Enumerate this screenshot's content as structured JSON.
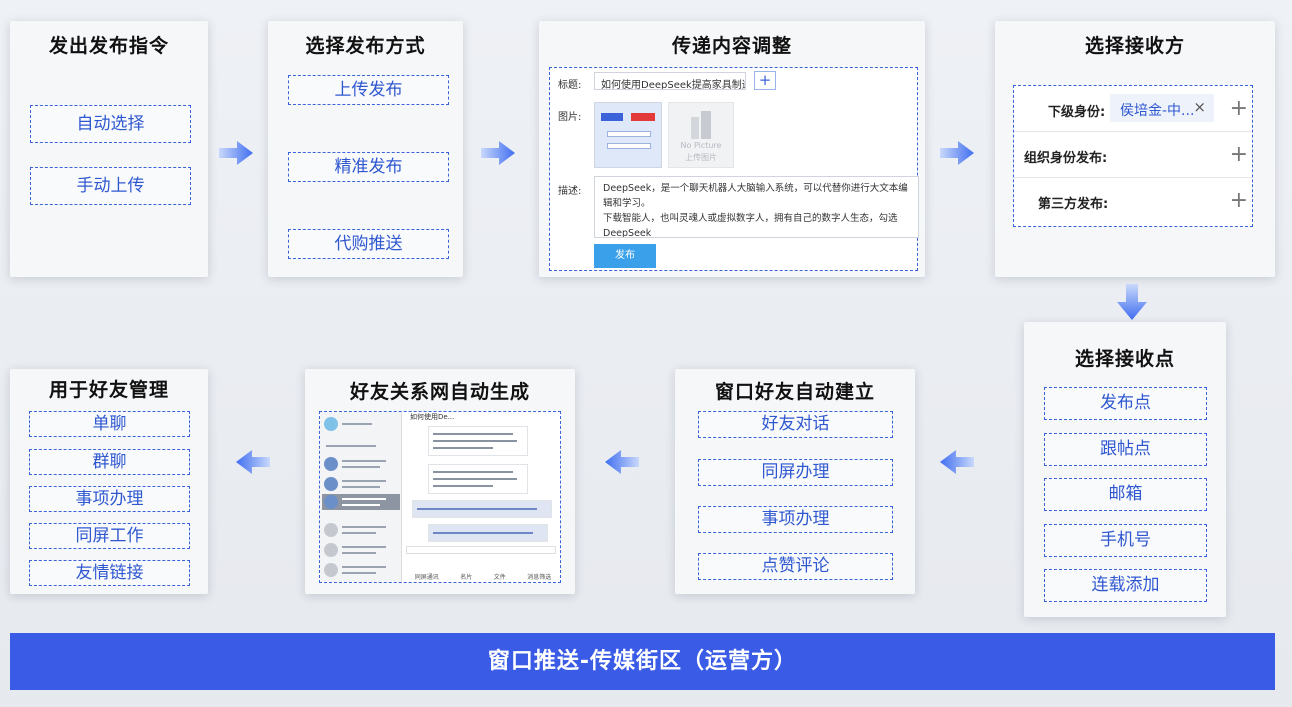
{
  "cards": {
    "issue": {
      "title": "发出发布指令",
      "items": [
        "自动选择",
        "手动上传"
      ]
    },
    "method": {
      "title": "选择发布方式",
      "items": [
        "上传发布",
        "精准发布",
        "代购推送"
      ]
    },
    "content": {
      "title": "传递内容调整",
      "title_label": "标题:",
      "title_value": "如何使用DeepSeek提高家具制造",
      "plus": "+",
      "image_label": "图片:",
      "thumb_placeholder_1": "No Picture",
      "thumb_placeholder_2": "上传图片",
      "desc_label": "描述:",
      "desc_lines": [
        "DeepSeek，是一个聊天机器人大脑输入系统，可以代替你进行大文本编",
        "辑和学习。",
        "下载智能人，也叫灵魂人或虚拟数字人，拥有自己的数字人生态，勾选",
        "DeepSeek"
      ],
      "submit": "发布"
    },
    "receiver": {
      "title": "选择接收方",
      "rows": [
        {
          "label": "下级身份:",
          "tag": "侯培金-中...",
          "tag_close": "×",
          "plus": "+"
        },
        {
          "label": "组织身份发布:",
          "plus": "+"
        },
        {
          "label": "第三方发布:",
          "plus": "+"
        }
      ]
    },
    "point": {
      "title": "选择接收点",
      "items": [
        "发布点",
        "跟帖点",
        "邮箱",
        "手机号",
        "连载添加"
      ]
    },
    "window": {
      "title": "窗口好友自动建立",
      "items": [
        "好友对话",
        "同屏办理",
        "事项办理",
        "点赞评论"
      ]
    },
    "network": {
      "title": "好友关系网自动生成",
      "chat_header": "如何使用De...",
      "chat_toolbar": [
        "同屏通讯",
        "名片",
        "文件",
        "消息筛选"
      ]
    },
    "manage": {
      "title": "用于好友管理",
      "items": [
        "单聊",
        "群聊",
        "事项办理",
        "同屏工作",
        "友情链接"
      ]
    }
  },
  "footer": "窗口推送-传媒街区（运营方）",
  "colors": {
    "accent": "#3b63d9",
    "footer": "#3a5be6",
    "arrow": "#4a7cf0"
  }
}
